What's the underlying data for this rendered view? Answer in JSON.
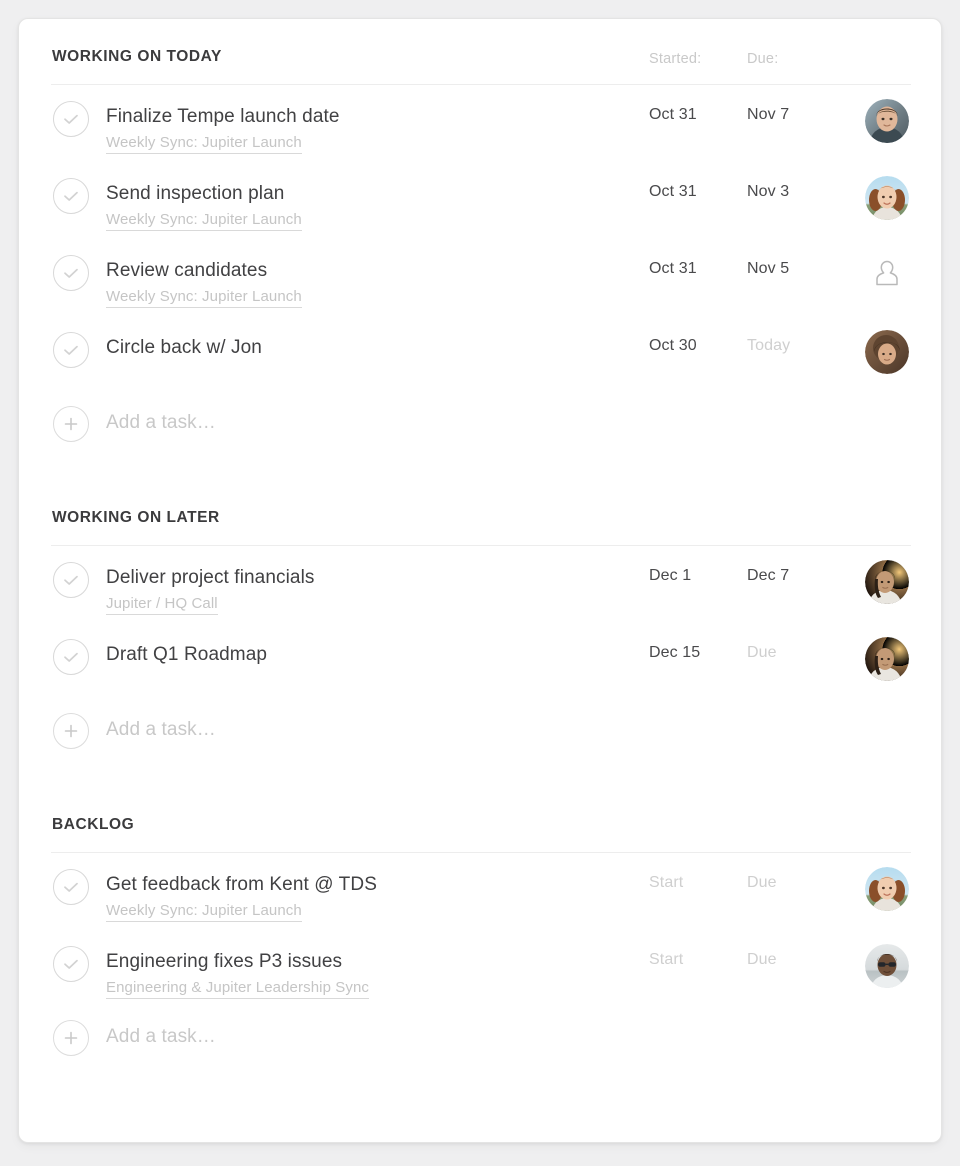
{
  "columns": {
    "started_label": "Started:",
    "due_label": "Due:"
  },
  "add_task_label": "Add a task…",
  "sections": [
    {
      "title": "WORKING ON TODAY",
      "show_column_heads": true,
      "tasks": [
        {
          "title": "Finalize Tempe launch date",
          "subtitle": "Weekly Sync: Jupiter Launch",
          "started": "Oct 31",
          "due": "Nov 7",
          "started_muted": false,
          "due_muted": false,
          "avatar": "photo-man-brown-hair"
        },
        {
          "title": "Send inspection plan",
          "subtitle": "Weekly Sync: Jupiter Launch",
          "started": "Oct 31",
          "due": "Nov 3",
          "started_muted": false,
          "due_muted": false,
          "avatar": "photo-woman-curly-hair-sky"
        },
        {
          "title": "Review candidates",
          "subtitle": "Weekly Sync: Jupiter Launch",
          "started": "Oct 31",
          "due": "Nov 5",
          "started_muted": false,
          "due_muted": false,
          "avatar": "person-outline-icon"
        },
        {
          "title": "Circle back w/ Jon",
          "subtitle": "",
          "started": "Oct 30",
          "due": "Today",
          "started_muted": false,
          "due_muted": true,
          "avatar": "photo-woman-dark-hair"
        }
      ]
    },
    {
      "title": "WORKING ON LATER",
      "show_column_heads": false,
      "tasks": [
        {
          "title": "Deliver project financials",
          "subtitle": "Jupiter / HQ Call",
          "started": "Dec 1",
          "due": "Dec 7",
          "started_muted": false,
          "due_muted": false,
          "avatar": "photo-woman-golden"
        },
        {
          "title": "Draft Q1 Roadmap",
          "subtitle": "",
          "started": "Dec 15",
          "due": "Due",
          "started_muted": false,
          "due_muted": true,
          "avatar": "photo-woman-golden"
        }
      ]
    },
    {
      "title": "BACKLOG",
      "show_column_heads": false,
      "tasks": [
        {
          "title": "Get feedback from Kent @ TDS",
          "subtitle": "Weekly Sync: Jupiter Launch",
          "started": "Start",
          "due": "Due",
          "started_muted": true,
          "due_muted": true,
          "avatar": "photo-woman-curly-hair-sky"
        },
        {
          "title": "Engineering fixes P3 issues",
          "subtitle": "Engineering & Jupiter Leadership Sync",
          "started": "Start",
          "due": "Due",
          "started_muted": true,
          "due_muted": true,
          "avatar": "photo-person-sunglasses"
        }
      ]
    }
  ],
  "colors": {
    "page_background": "#efeff0",
    "card_background": "#ffffff",
    "title_text": "#414143",
    "header_text": "#3b3b3d",
    "muted_text": "#c8c8c8",
    "rule": "#ededed"
  }
}
